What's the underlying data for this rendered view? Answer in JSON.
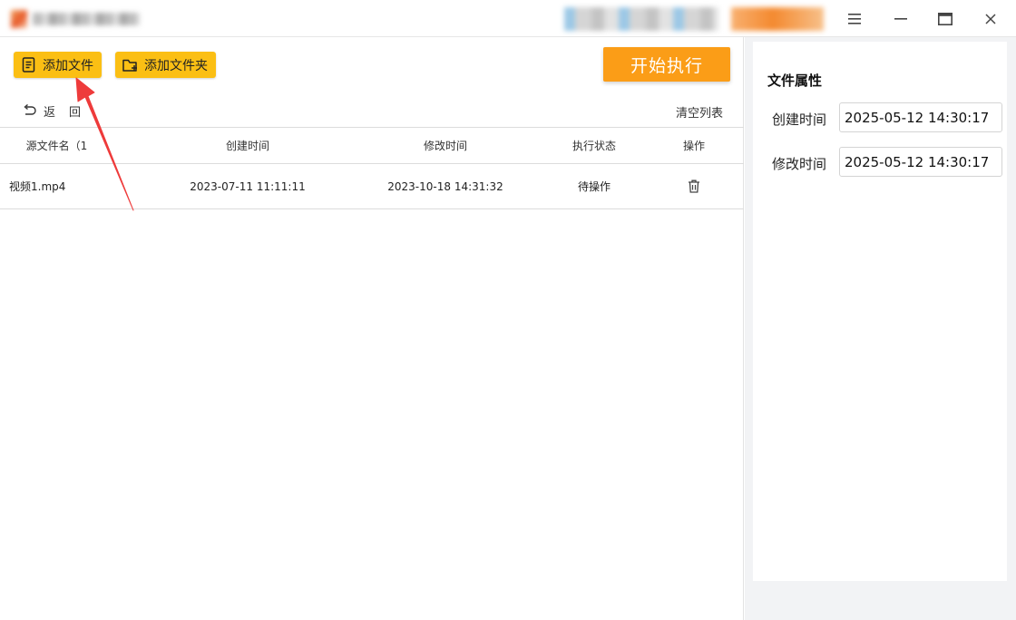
{
  "titlebar": {
    "menu_icon": "hamburger-icon",
    "min_icon": "minimize-icon",
    "max_icon": "maximize-icon",
    "close_icon": "close-icon"
  },
  "toolbar": {
    "add_file_label": "添加文件",
    "add_folder_label": "添加文件夹",
    "start_label": "开始执行",
    "back_label_1": "返",
    "back_label_2": "回",
    "clear_list_label": "清空列表"
  },
  "table": {
    "columns": [
      "源文件名（1",
      "创建时间",
      "修改时间",
      "执行状态",
      "操作"
    ],
    "rows": [
      {
        "name": "视频1.mp4",
        "created": "2023-07-11 11:11:11",
        "modified": "2023-10-18 14:31:32",
        "status": "待操作",
        "action_icon": "trash-icon"
      }
    ]
  },
  "properties": {
    "title": "文件属性",
    "created_label": "创建时间",
    "created_value": "2025-05-12 14:30:17",
    "modified_label": "修改时间",
    "modified_value": "2025-05-12 14:30:17"
  },
  "colors": {
    "button_yellow": "#fbbf14",
    "start_orange": "#fb9d17",
    "arrow_red": "#ee3b3b",
    "panel_gray": "#f2f3f5"
  }
}
